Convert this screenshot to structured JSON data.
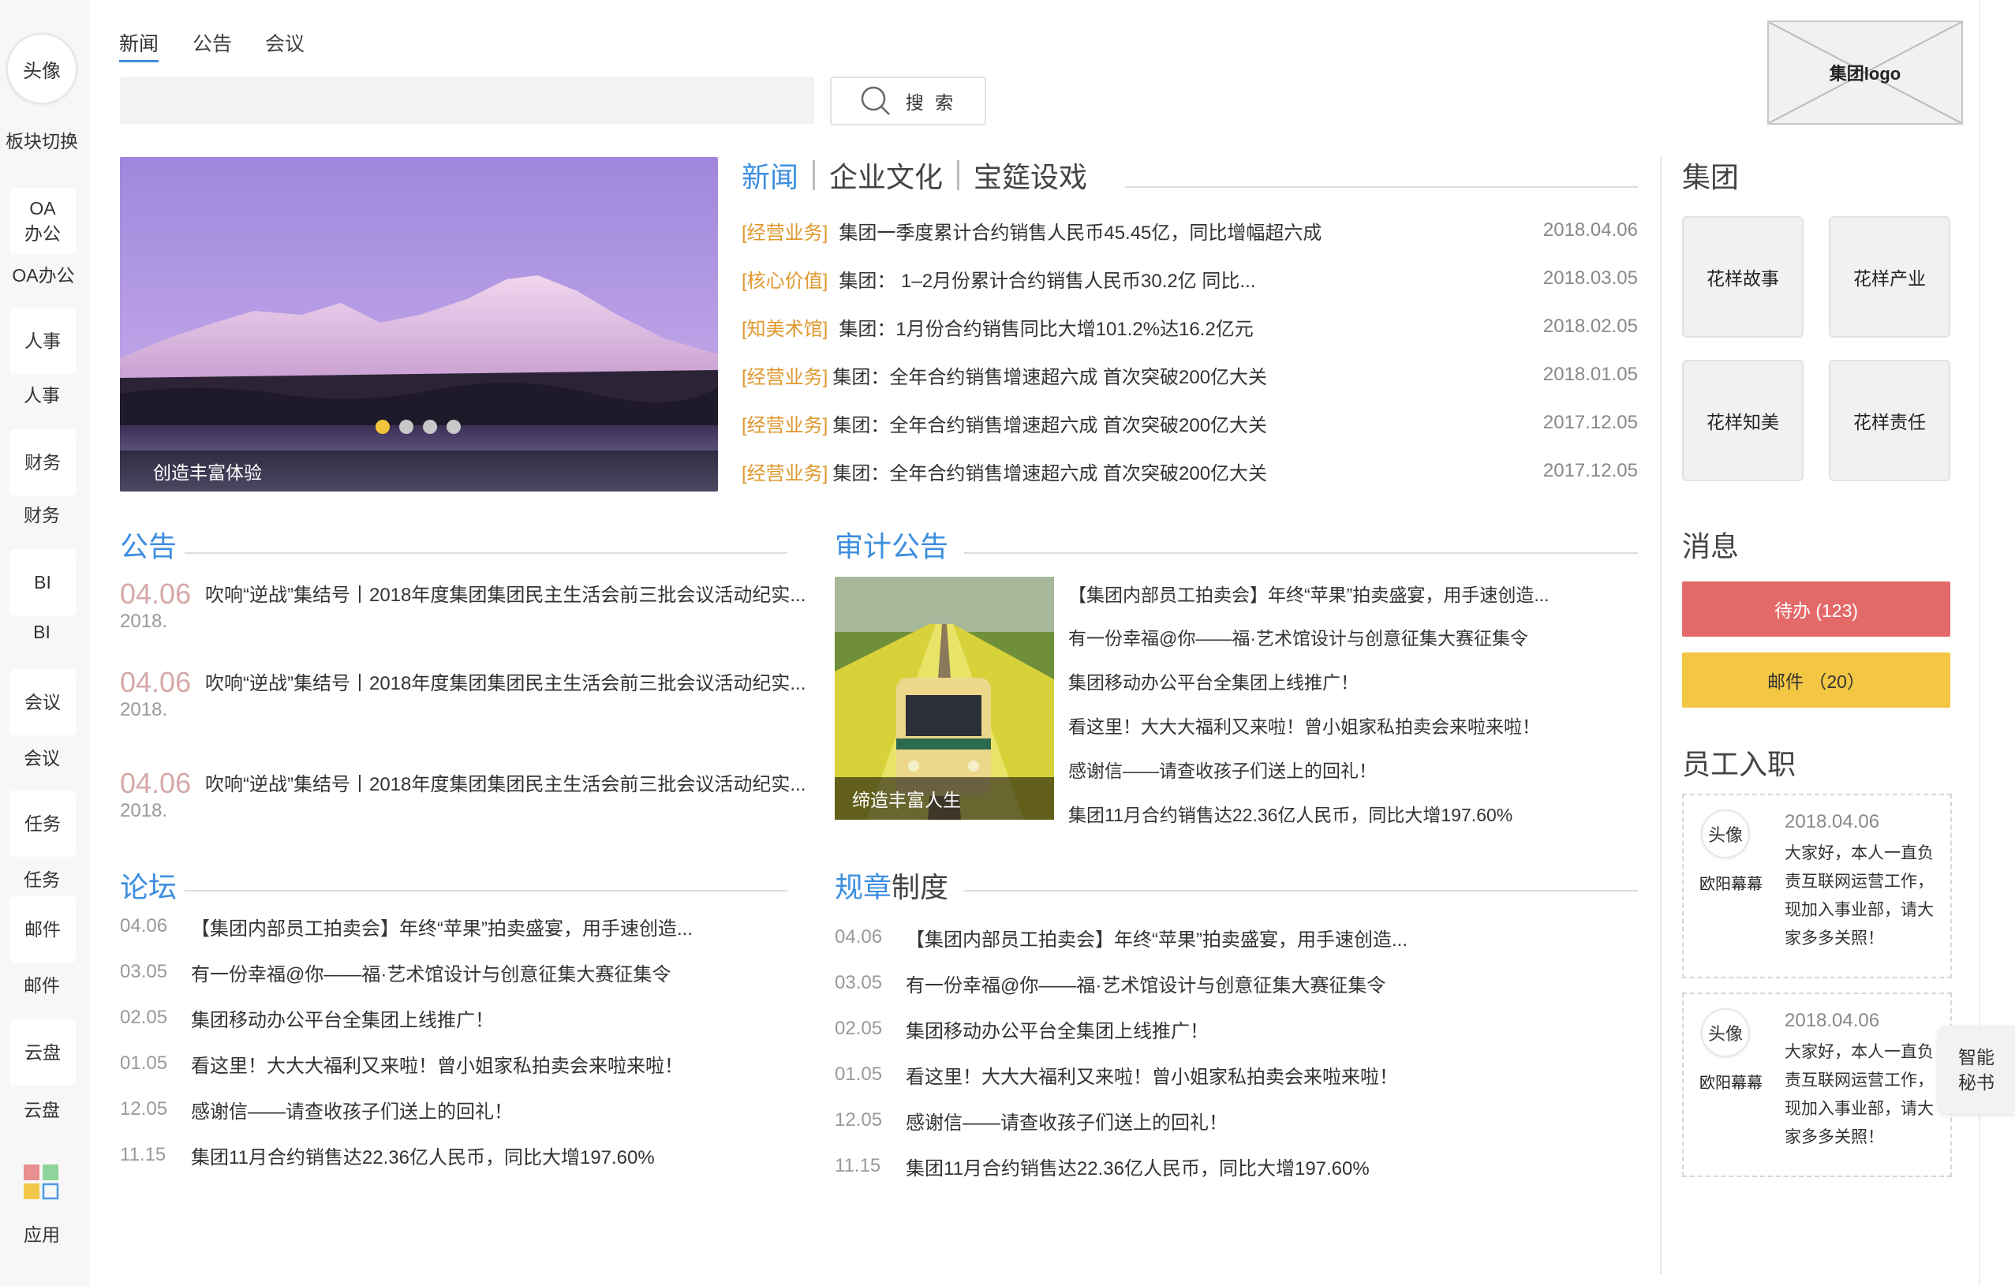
{
  "rail": {
    "avatar": "头像",
    "switch_label": "板块切换",
    "items": [
      {
        "box": "OA办公",
        "label": "OA办公"
      },
      {
        "box": "人事",
        "label": "人事"
      },
      {
        "box": "财务",
        "label": "财务"
      },
      {
        "box": "BI",
        "label": "BI"
      },
      {
        "box": "会议",
        "label": "会议"
      },
      {
        "box": "任务",
        "label": "任务"
      },
      {
        "box": "邮件",
        "label": "邮件"
      },
      {
        "box": "云盘",
        "label": "云盘"
      }
    ],
    "apps_label": "应用"
  },
  "top_tabs": [
    "新闻",
    "公告",
    "会议"
  ],
  "search": {
    "placeholder": "",
    "button_label": "搜 索"
  },
  "logo_text": "集团logo",
  "carousel": {
    "caption": "创造丰富体验",
    "active_dot": 0,
    "dot_count": 4
  },
  "news": {
    "tabs": [
      "新闻",
      "企业文化",
      "宝筵设戏"
    ],
    "rows": [
      {
        "tag": "[经营业务]",
        "title": "集团一季度累计合约销售人民币45.45亿，同比增幅超六成",
        "date": "2018.04.06"
      },
      {
        "tag": "[核心价值]",
        "title": "集团： 1–2月份累计合约销售人民币30.2亿 同比...",
        "date": "2018.03.05"
      },
      {
        "tag": "[知美术馆]",
        "title": "集团：1月份合约销售同比大增101.2%达16.2亿元",
        "date": "2018.02.05"
      },
      {
        "tag": "[经营业务]",
        "title": "集团：全年合约销售增速超六成 首次突破200亿大关",
        "date": "2018.01.05"
      },
      {
        "tag": "[经营业务]",
        "title": "集团：全年合约销售增速超六成 首次突破200亿大关",
        "date": "2017.12.05"
      },
      {
        "tag": "[经营业务]",
        "title": "集团：全年合约销售增速超六成 首次突破200亿大关",
        "date": "2017.12.05"
      }
    ]
  },
  "announcements": {
    "title": "公告",
    "items": [
      {
        "day": "04.06",
        "year": "2018.",
        "text": "吹响“逆战”集结号丨2018年度集团集团民主生活会前三批会议活动纪实..."
      },
      {
        "day": "04.06",
        "year": "2018.",
        "text": "吹响“逆战”集结号丨2018年度集团集团民主生活会前三批会议活动纪实..."
      },
      {
        "day": "04.06",
        "year": "2018.",
        "text": "吹响“逆战”集结号丨2018年度集团集团民主生活会前三批会议活动纪实..."
      }
    ]
  },
  "audit": {
    "title": "审计公告",
    "image_caption": "缔造丰富人生",
    "items": [
      "【集团内部员工拍卖会】年终“苹果”拍卖盛宴，用手速创造...",
      "有一份幸福@你——福·艺术馆设计与创意征集大赛征集令",
      "集团移动办公平台全集团上线推广！",
      "看这里！大大大福利又来啦！曾小姐家私拍卖会来啦来啦！",
      "感谢信——请查收孩子们送上的回礼！",
      "集团11月合约销售达22.36亿人民币，同比大增197.60%"
    ]
  },
  "forum": {
    "title": "论坛",
    "items": [
      {
        "date": "04.06",
        "text": "【集团内部员工拍卖会】年终“苹果”拍卖盛宴，用手速创造..."
      },
      {
        "date": "03.05",
        "text": "有一份幸福@你——福·艺术馆设计与创意征集大赛征集令"
      },
      {
        "date": "02.05",
        "text": "集团移动办公平台全集团上线推广！"
      },
      {
        "date": "01.05",
        "text": "看这里！大大大福利又来啦！曾小姐家私拍卖会来啦来啦！"
      },
      {
        "date": "12.05",
        "text": "感谢信——请查收孩子们送上的回礼！"
      },
      {
        "date": "11.15",
        "text": "集团11月合约销售达22.36亿人民币，同比大增197.60%"
      }
    ]
  },
  "rules": {
    "title_accent": "规章",
    "title_rest": "制度",
    "items": [
      {
        "date": "04.06",
        "text": "【集团内部员工拍卖会】年终“苹果”拍卖盛宴，用手速创造..."
      },
      {
        "date": "03.05",
        "text": "有一份幸福@你——福·艺术馆设计与创意征集大赛征集令"
      },
      {
        "date": "02.05",
        "text": "集团移动办公平台全集团上线推广！"
      },
      {
        "date": "01.05",
        "text": "看这里！大大大福利又来啦！曾小姐家私拍卖会来啦来啦！"
      },
      {
        "date": "12.05",
        "text": "感谢信——请查收孩子们送上的回礼！"
      },
      {
        "date": "11.15",
        "text": "集团11月合约销售达22.36亿人民币，同比大增197.60%"
      }
    ]
  },
  "group": {
    "title": "集团",
    "buttons": [
      "花样故事",
      "花样产业",
      "花样知美",
      "花样责任"
    ]
  },
  "messages": {
    "title": "消息",
    "todo": "待办 (123)",
    "mail": "邮件 （20）"
  },
  "employees": {
    "title": "员工入职",
    "cards": [
      {
        "avatar": "头像",
        "name": "欧阳幕幕",
        "date": "2018.04.06",
        "text": "大家好，本人一直负责互联网运营工作，现加入事业部，请大家多多关照！"
      },
      {
        "avatar": "头像",
        "name": "欧阳幕幕",
        "date": "2018.04.06",
        "text": "大家好，本人一直负责互联网运营工作，现加入事业部，请大家多多关照！"
      }
    ]
  },
  "assistant": "智能秘书",
  "colors": {
    "accent": "#3d8ee0",
    "tag": "#e0982e",
    "todo": "#e46a6a",
    "mail": "#f3c744",
    "ann_day": "#d7a8a8"
  }
}
